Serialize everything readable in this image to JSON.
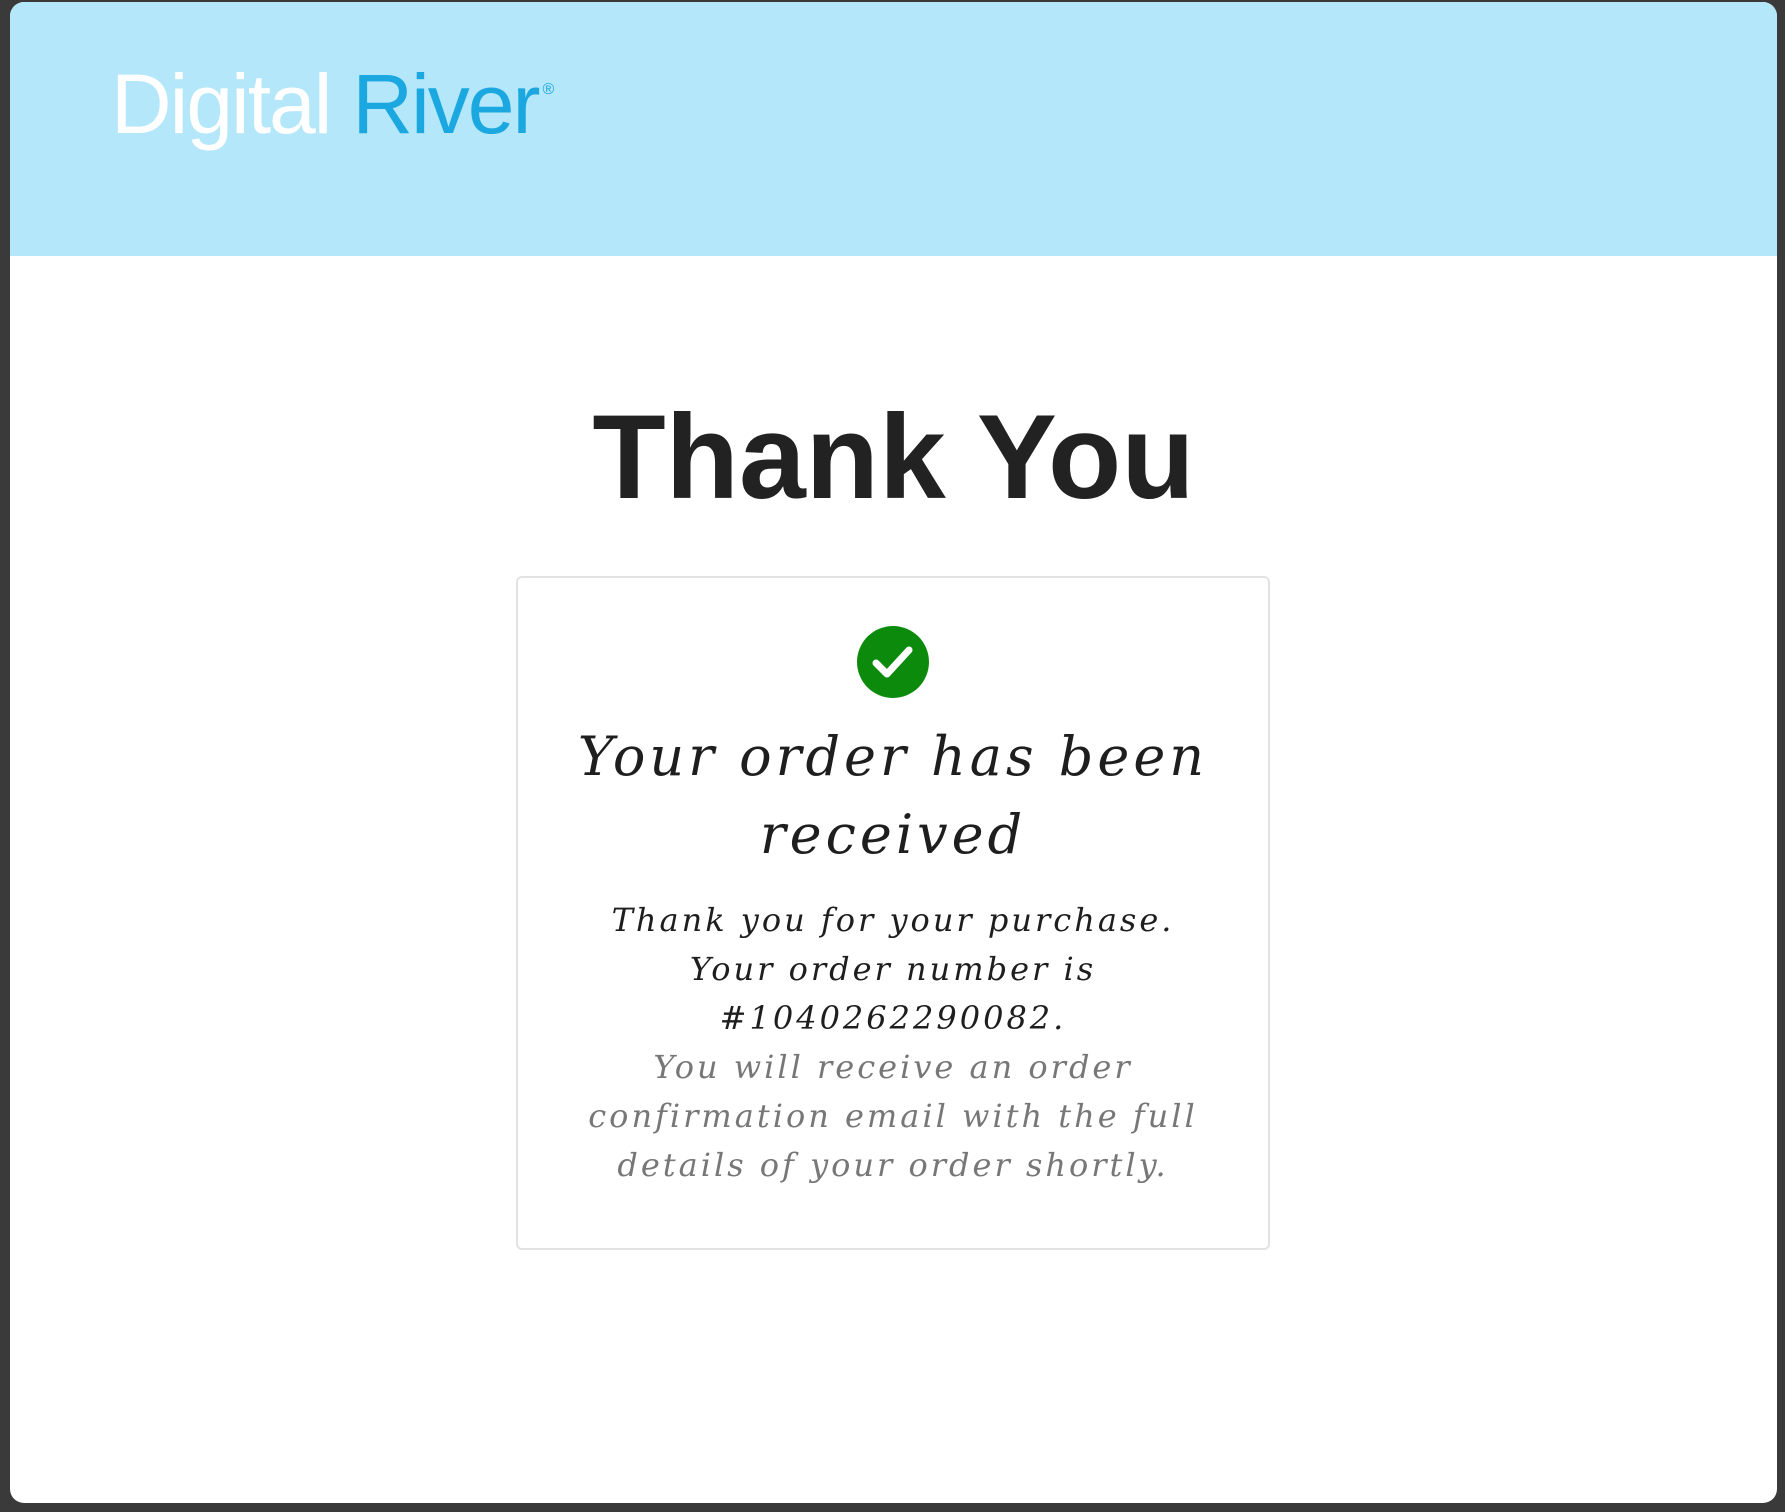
{
  "header": {
    "logo_part1": "Digital",
    "logo_part2": "River",
    "logo_mark": "®",
    "background_color": "#b3e7f9",
    "accent_color": "#1ba7df"
  },
  "main": {
    "title": "Thank You",
    "card": {
      "icon": "check-circle-icon",
      "icon_color": "#0b8a0b",
      "heading": "Your order has been received",
      "line1": "Thank you for your purchase.",
      "line2": "Your order number is",
      "order_number": "#1040262290082.",
      "note": "You will receive an order confirmation email with the full details of your order shortly."
    }
  }
}
